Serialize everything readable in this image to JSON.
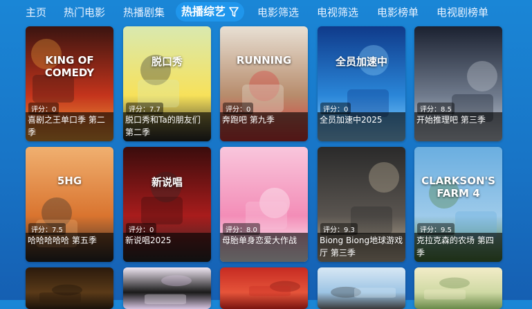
{
  "nav": {
    "items": [
      {
        "label": "主页"
      },
      {
        "label": "热门电影"
      },
      {
        "label": "热播剧集"
      },
      {
        "label": "热播综艺",
        "active": true
      },
      {
        "label": "电影筛选"
      },
      {
        "label": "电视筛选"
      },
      {
        "label": "电影榜单"
      },
      {
        "label": "电视剧榜单"
      }
    ],
    "filter_icon": "filter-icon"
  },
  "cards": [
    {
      "rating": "评分：0",
      "title": "喜剧之王单口季 第二季",
      "poster_text": "KING OF COMEDY",
      "colors": [
        "#3a1410",
        "#c4341c",
        "#f2a13a"
      ]
    },
    {
      "rating": "评分：7.7",
      "title": "脱口秀和Ta的朋友们 第二季",
      "poster_text": "脱口秀",
      "colors": [
        "#d9e9b0",
        "#f7e15a",
        "#2c2c2c"
      ]
    },
    {
      "rating": "评分：0",
      "title": "奔跑吧 第九季",
      "poster_text": "RUNNING",
      "colors": [
        "#e8e0d4",
        "#b78c6c",
        "#d83a3a"
      ]
    },
    {
      "rating": "评分：0",
      "title": "全员加速中2025",
      "poster_text": "全员加速中",
      "colors": [
        "#0f3a8a",
        "#2a86d8",
        "#8fd3ff"
      ]
    },
    {
      "rating": "评分：8.5",
      "title": "开始推理吧 第三季",
      "poster_text": "",
      "colors": [
        "#1b2130",
        "#6f7a8c",
        "#c9cfd8"
      ]
    },
    {
      "rating": "评分：7.5",
      "title": "哈哈哈哈哈 第五季",
      "poster_text": "5HG",
      "colors": [
        "#f0b070",
        "#d9742f",
        "#2a2a2a"
      ]
    },
    {
      "rating": "评分：0",
      "title": "新说唱2025",
      "poster_text": "新说唱",
      "colors": [
        "#3a0c0c",
        "#a81c1c",
        "#2b2b2b"
      ]
    },
    {
      "rating": "评分：8.0",
      "title": "母胎单身恋爱大作战",
      "poster_text": "",
      "colors": [
        "#f9c6dc",
        "#f38db7",
        "#ffffff"
      ]
    },
    {
      "rating": "评分：9.3",
      "title": "Biong Biong地球游戏厅 第三季",
      "poster_text": "",
      "colors": [
        "#2a2a2a",
        "#5a5550",
        "#c9b9a0"
      ]
    },
    {
      "rating": "评分：9.5",
      "title": "克拉克森的农场 第四季",
      "poster_text": "CLARKSON'S FARM 4",
      "colors": [
        "#6aaee0",
        "#9dcaea",
        "#4e7d3a"
      ]
    },
    {
      "rating": "",
      "title": "",
      "poster_text": "",
      "colors": [
        "#2b1a0c",
        "#5a3a18",
        "#1a120a"
      ]
    },
    {
      "rating": "",
      "title": "",
      "poster_text": "",
      "colors": [
        "#efe6f2",
        "#1a1a1a",
        "#d6c4e0"
      ]
    },
    {
      "rating": "",
      "title": "",
      "poster_text": "",
      "colors": [
        "#c62b22",
        "#e6543a",
        "#7a1410"
      ]
    },
    {
      "rating": "",
      "title": "",
      "poster_text": "",
      "colors": [
        "#d8e8f4",
        "#9cc4e4",
        "#3a3a3a"
      ]
    },
    {
      "rating": "",
      "title": "",
      "poster_text": "",
      "colors": [
        "#f2ecc8",
        "#cfd9a4",
        "#6a8a4a"
      ]
    }
  ]
}
